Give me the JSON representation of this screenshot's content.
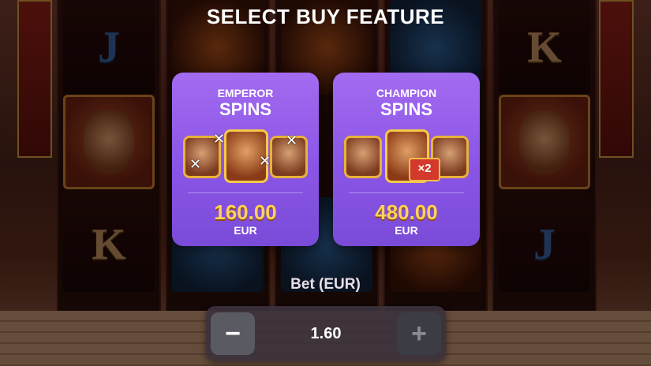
{
  "header": {
    "title": "SELECT BUY FEATURE"
  },
  "features": [
    {
      "name_line1": "EMPEROR",
      "name_line2": "SPINS",
      "price": "160.00",
      "currency": "EUR",
      "badge_icons": [
        "x-mark-icon",
        "x-mark-icon",
        "x-mark-icon",
        "x-mark-icon"
      ]
    },
    {
      "name_line1": "CHAMPION",
      "name_line2": "SPINS",
      "price": "480.00",
      "currency": "EUR",
      "multiplier": "×2"
    }
  ],
  "bet": {
    "label": "Bet (EUR)",
    "value": "1.60",
    "minus_label": "−",
    "plus_label": "+"
  },
  "reels": {
    "symbols": [
      [
        "J",
        "hero",
        "K"
      ],
      [
        "tiger",
        "blue",
        "tiger"
      ],
      [
        "K",
        "hero",
        "J"
      ]
    ]
  },
  "colors": {
    "card": "#8a55e6",
    "price": "#ffd257",
    "accent_gold": "#e8b23a"
  }
}
